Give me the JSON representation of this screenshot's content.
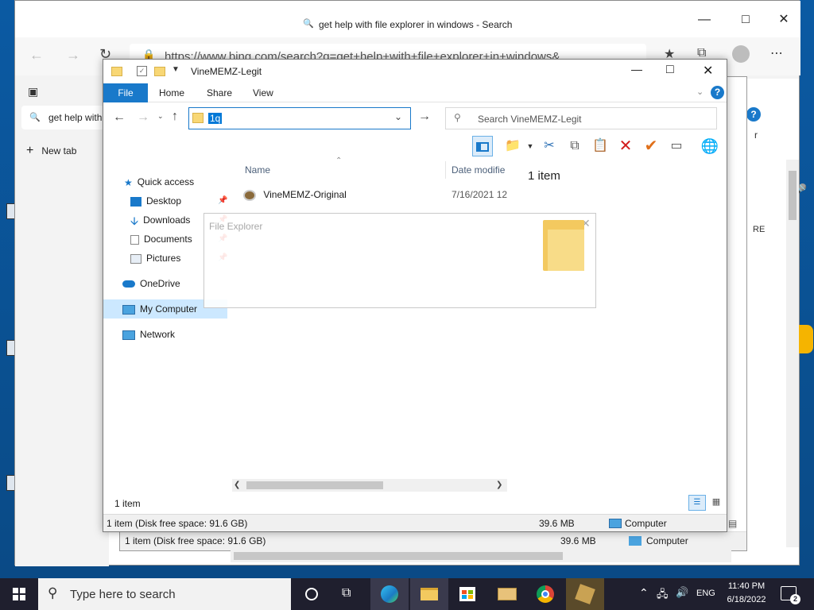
{
  "browser": {
    "tab_title": "get help with file explorer in windows - Search",
    "url": "https://www.bing.com/search?q=get+help+with+file+explorer+in+windows&...",
    "side_tab_label": "get help with",
    "new_tab_label": "New tab",
    "right_partial_text_1": "r",
    "right_partial_text_2": "RE"
  },
  "back_explorer": {
    "status_items": "1 item (Disk free space: 91.6 GB)",
    "status_size": "39.6 MB",
    "status_location": "Computer"
  },
  "explorer": {
    "title": "VineMEMZ-Legit",
    "ribbon_tabs": [
      "File",
      "Home",
      "Share",
      "View"
    ],
    "address_value": "1q",
    "search_placeholder": "Search VineMEMZ-Legit",
    "nav_items": [
      {
        "label": "Quick access"
      },
      {
        "label": "Desktop"
      },
      {
        "label": "Downloads"
      },
      {
        "label": "Documents"
      },
      {
        "label": "Pictures"
      },
      {
        "label": "OneDrive"
      },
      {
        "label": "My Computer"
      },
      {
        "label": "Network"
      }
    ],
    "columns": {
      "name": "Name",
      "date": "Date modifie"
    },
    "files": [
      {
        "name": "VineMEMZ-Original",
        "date": "7/16/2021 12:"
      }
    ],
    "preview_text": "1 item",
    "item_count": "1 item",
    "status_items": "1 item (Disk free space: 91.6 GB)",
    "status_size": "39.6 MB",
    "status_location": "Computer"
  },
  "overlay": {
    "title": "File Explorer"
  },
  "taskbar": {
    "search_placeholder": "Type here to search",
    "language": "ENG",
    "time": "11:40 PM",
    "date": "6/18/2022",
    "notification_count": "2"
  },
  "colors": {
    "accent": "#1979ca",
    "selection": "#0078d7",
    "desktop": "#0a4d8c",
    "taskbar": "#1f1f2e"
  }
}
